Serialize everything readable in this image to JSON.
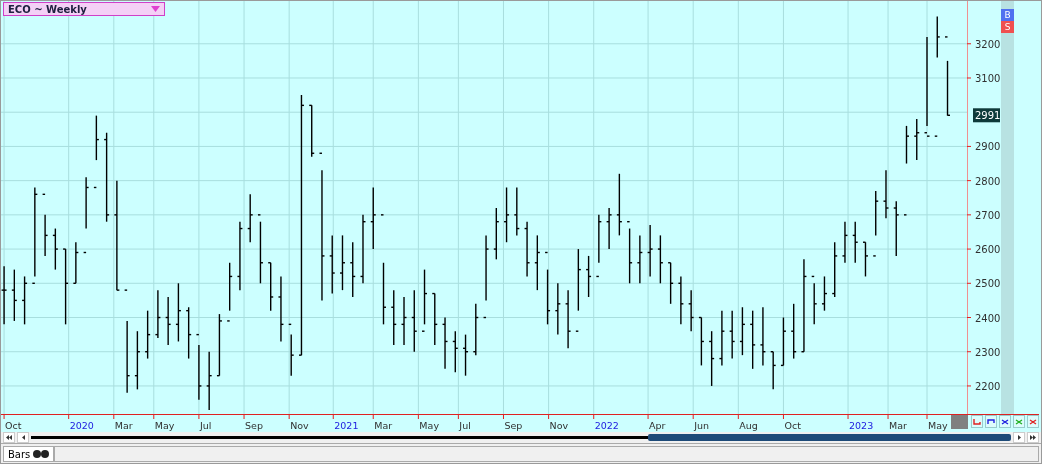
{
  "chart": {
    "title": "ECO ~ Weekly",
    "last_price": "2991",
    "price_labels": [
      "3200",
      "3100",
      "2900",
      "2800",
      "2700",
      "2600",
      "2500",
      "2400",
      "2300",
      "2200"
    ],
    "date_labels": [
      {
        "label": "Oct",
        "highlighted": false
      },
      {
        "label": "2020",
        "highlighted": true
      },
      {
        "label": "Mar",
        "highlighted": false
      },
      {
        "label": "May",
        "highlighted": false
      },
      {
        "label": "Jul",
        "highlighted": false
      },
      {
        "label": "Sep",
        "highlighted": false
      },
      {
        "label": "Nov",
        "highlighted": false
      },
      {
        "label": "2021",
        "highlighted": true
      },
      {
        "label": "Mar",
        "highlighted": false
      },
      {
        "label": "May",
        "highlighted": false
      },
      {
        "label": "Jul",
        "highlighted": false
      },
      {
        "label": "Sep",
        "highlighted": false
      },
      {
        "label": "Nov",
        "highlighted": false
      },
      {
        "label": "2022",
        "highlighted": true
      },
      {
        "label": "Apr",
        "highlighted": false
      },
      {
        "label": "Jun",
        "highlighted": false
      },
      {
        "label": "Aug",
        "highlighted": false
      },
      {
        "label": "Oct",
        "highlighted": false
      },
      {
        "label": "2023",
        "highlighted": true
      },
      {
        "label": "Mar",
        "highlighted": false
      },
      {
        "label": "May",
        "highlighted": false
      }
    ]
  },
  "side_buttons": [
    "B",
    "S"
  ],
  "bottom_tabs": [
    {
      "label": "Bars",
      "selected": true
    }
  ]
}
